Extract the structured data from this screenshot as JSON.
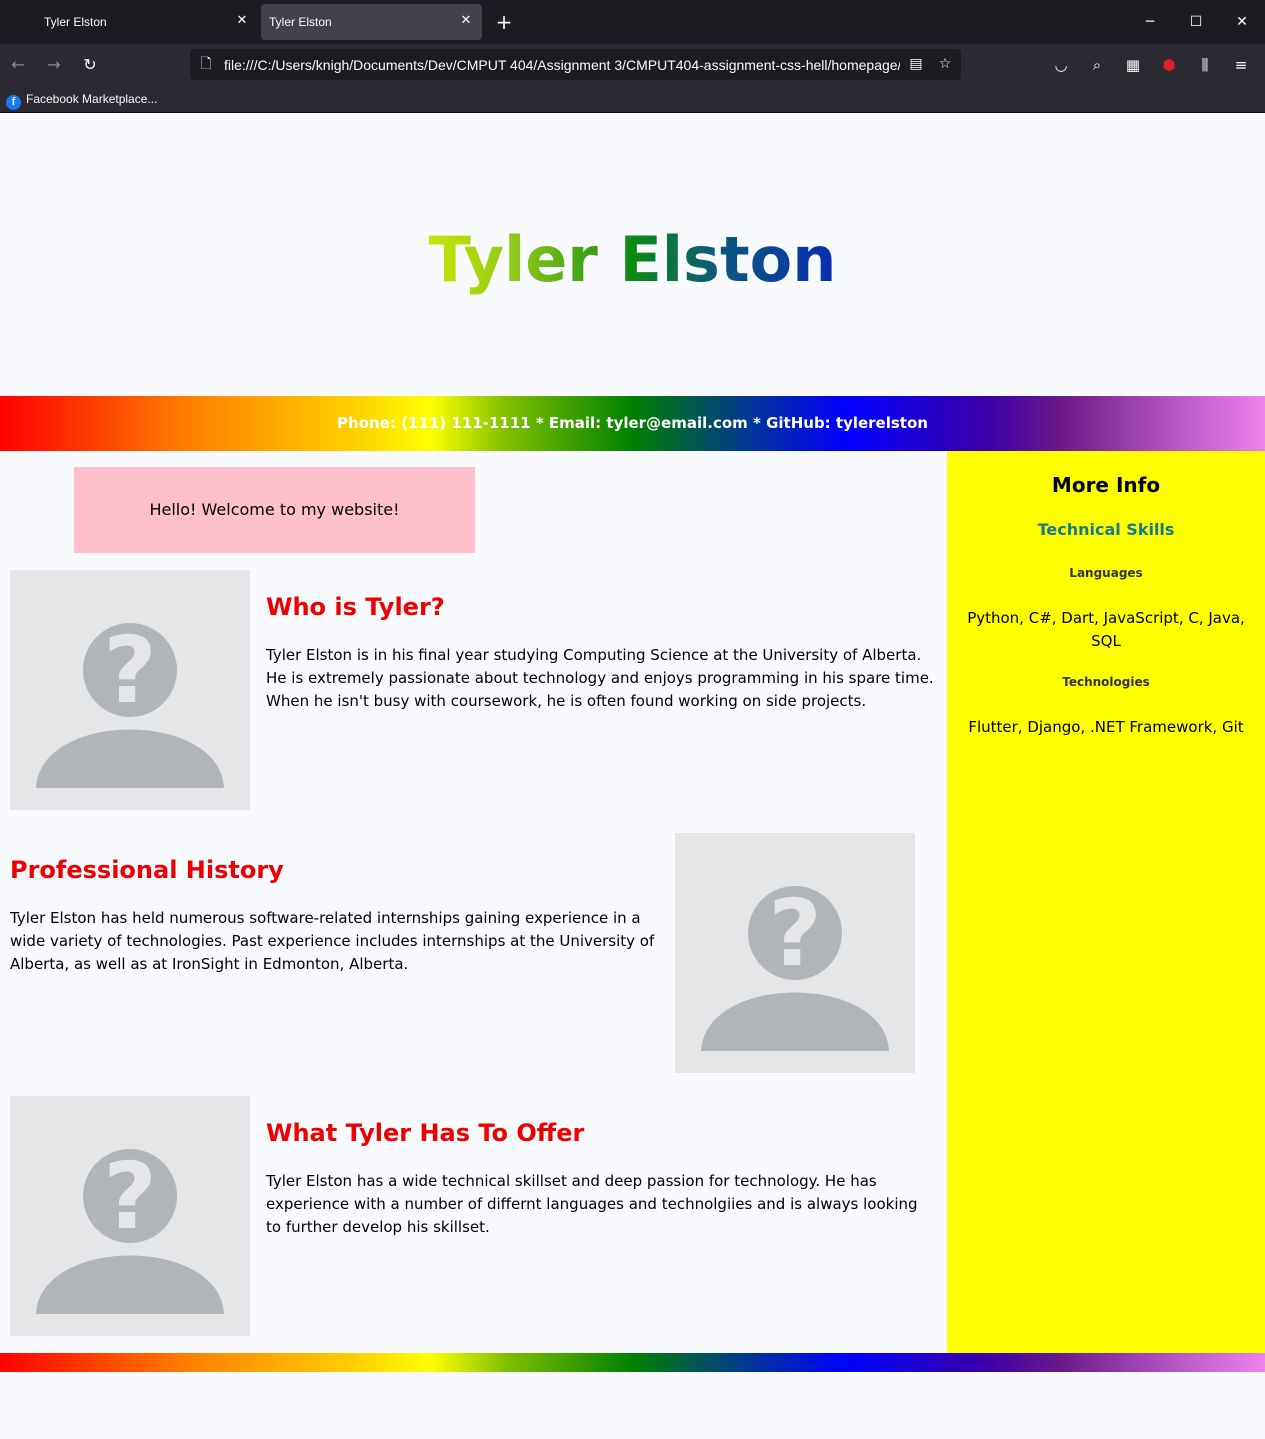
{
  "browser": {
    "tabs": [
      {
        "title": "Tyler Elston",
        "active": false
      },
      {
        "title": "Tyler Elston",
        "active": true
      }
    ],
    "url": "file:///C:/Users/knigh/Documents/Dev/CMPUT 404/Assignment 3/CMPUT404-assignment-css-hell/homepage/",
    "bookmarks": [
      {
        "label": "Facebook Marketplace..."
      }
    ],
    "icons": {
      "tab_close": "close-icon",
      "new_tab": "plus-icon",
      "back": "back-arrow-icon",
      "forward": "forward-arrow-icon",
      "reload": "reload-icon",
      "page": "page-icon",
      "reader": "reader-view-icon",
      "bookmark": "star-icon",
      "pocket": "pocket-icon",
      "search": "search-icon",
      "extensions": "extensions-icon",
      "ublock": "ublock-icon",
      "library": "library-icon",
      "menu": "hamburger-menu-icon"
    }
  },
  "page": {
    "title": "Tyler Elston",
    "contact": "Phone: (111) 111-1111 * Email: tyler@email.com * GitHub: tylerelston",
    "welcome": "Hello! Welcome to my website!",
    "sections": [
      {
        "heading": "Who is Tyler?",
        "body": "Tyler Elston is in his final year studying Computing Science at the University of Alberta. He is extremely passionate about technology and enjoys programming in his spare time. When he isn't busy with coursework, he is often found working on side projects."
      },
      {
        "heading": "Professional History",
        "body": "Tyler Elston has held numerous software-related internships gaining experience in a wide variety of technologies. Past experience includes internships at the University of Alberta, as well as at IronSight in Edmonton, Alberta."
      },
      {
        "heading": "What Tyler Has To Offer",
        "body": "Tyler Elston has a wide technical skillset and deep passion for technology. He has experience with a number of differnt languages and technolgiies and is always looking to further develop his skillset."
      }
    ],
    "sidebar": {
      "title": "More Info",
      "subtitle": "Technical Skills",
      "languages_heading": "Languages",
      "languages": "Python, C#, Dart, JavaScript, C, Java, SQL",
      "technologies_heading": "Technologies",
      "technologies": "Flutter, Django, .NET Framework, Git"
    }
  },
  "colors": {
    "heading_red": "#ee0000",
    "sidebar_yellow": "#ffff00",
    "welcome_pink": "#ffc0cb",
    "skills_teal": "#157a8a",
    "browser_dark": "#1c1b22"
  }
}
